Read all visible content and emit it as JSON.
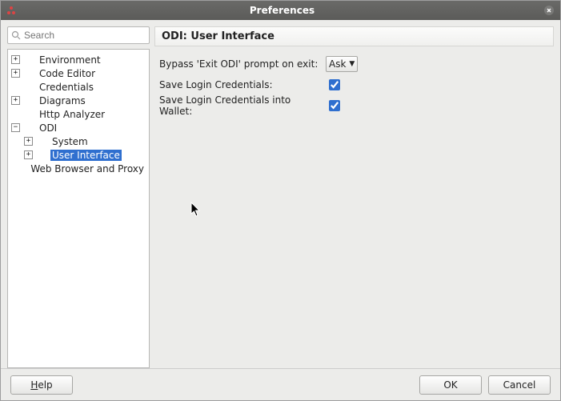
{
  "window": {
    "title": "Preferences"
  },
  "search": {
    "placeholder": "Search"
  },
  "tree": {
    "items": [
      {
        "label": "Environment"
      },
      {
        "label": "Code Editor"
      },
      {
        "label": "Credentials"
      },
      {
        "label": "Diagrams"
      },
      {
        "label": "Http Analyzer"
      },
      {
        "label": "ODI",
        "children": [
          {
            "label": "System"
          },
          {
            "label": "User Interface",
            "selected": true
          }
        ]
      },
      {
        "label": "Web Browser and Proxy"
      }
    ]
  },
  "panel": {
    "title": "ODI: User Interface",
    "rows": {
      "bypass": {
        "label": "Bypass 'Exit ODI' prompt on exit:",
        "value": "Ask"
      },
      "saveCreds": {
        "label": "Save Login Credentials:",
        "checked": true
      },
      "saveWallet": {
        "label": "Save Login Credentials into Wallet:",
        "checked": true
      }
    }
  },
  "buttons": {
    "help": "Help",
    "ok": "OK",
    "cancel": "Cancel"
  }
}
